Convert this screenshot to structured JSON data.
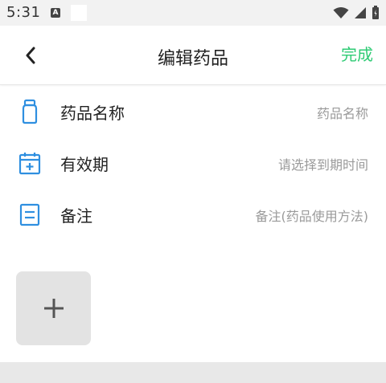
{
  "status_bar": {
    "time": "5:31",
    "badge": "A"
  },
  "header": {
    "title": "编辑药品",
    "done_label": "完成"
  },
  "form": {
    "rows": [
      {
        "icon": "medicine-bottle-icon",
        "label": "药品名称",
        "placeholder": "药品名称"
      },
      {
        "icon": "calendar-add-icon",
        "label": "有效期",
        "placeholder": "请选择到期时间"
      },
      {
        "icon": "note-icon",
        "label": "备注",
        "placeholder": "备注(药品使用方法)"
      }
    ]
  },
  "colors": {
    "accent_green": "#2ecb74",
    "icon_blue": "#2f8fe0",
    "placeholder_gray": "#9a9a9a",
    "add_tile_bg": "#e3e3e3"
  }
}
